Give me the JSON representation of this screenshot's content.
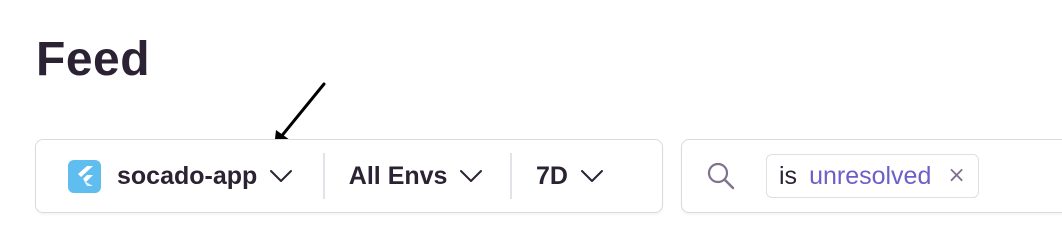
{
  "header": {
    "title": "Feed"
  },
  "filters": {
    "project": {
      "label": "socado-app",
      "icon": "flutter-icon",
      "icon_color": "#5fbdf0"
    },
    "environment": {
      "label": "All Envs"
    },
    "date_range": {
      "label": "7D"
    }
  },
  "search": {
    "icon": "search-icon",
    "token": {
      "key": "is",
      "value": "unresolved",
      "remove_symbol": "×"
    }
  },
  "colors": {
    "text": "#2b2233",
    "accent": "#6c5fc7",
    "border": "#ddd9e2"
  },
  "annotation": {
    "icon": "arrow-pointer-icon"
  }
}
